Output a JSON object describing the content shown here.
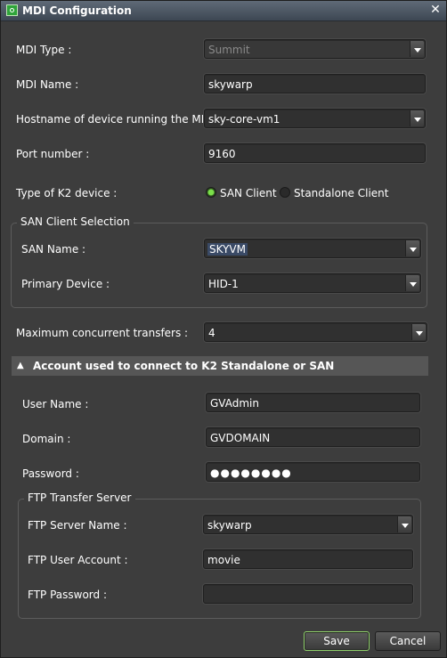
{
  "window": {
    "title": "MDI Configuration",
    "close": "✕"
  },
  "fields": {
    "mdi_type_label": "MDI Type :",
    "mdi_type_value": "Summit",
    "mdi_name_label": "MDI Name :",
    "mdi_name_value": "skywarp",
    "hostname_label": "Hostname of device running the MDI :",
    "hostname_value": "sky-core-vm1",
    "port_label": "Port number :",
    "port_value": "9160",
    "k2_type_label": "Type of K2 device :",
    "k2_option_san": "SAN Client",
    "k2_option_standalone": "Standalone Client",
    "k2_selected": "SAN Client"
  },
  "san": {
    "group_title": "SAN Client Selection",
    "san_name_label": "SAN Name :",
    "san_name_value": "SKYVM",
    "primary_label": "Primary Device :",
    "primary_value": "HID-1"
  },
  "transfers": {
    "label": "Maximum concurrent transfers :",
    "value": "4"
  },
  "account": {
    "section_title": "Account used to connect to K2 Standalone or SAN",
    "user_label": "User Name :",
    "user_value": "GVAdmin",
    "domain_label": "Domain :",
    "domain_value": "GVDOMAIN",
    "password_label": "Password :",
    "password_value": "●●●●●●●●"
  },
  "ftp": {
    "group_title": "FTP Transfer Server",
    "server_label": "FTP Server Name :",
    "server_value": "skywarp",
    "user_label": "FTP User Account :",
    "user_value": "movie",
    "password_label": "FTP Password :",
    "password_value": ""
  },
  "buttons": {
    "save": "Save",
    "cancel": "Cancel"
  },
  "icons": {
    "app": "app-icon",
    "close": "close-icon",
    "dropdown": "chevron-down-icon",
    "collapse": "chevron-up-icon"
  },
  "colors": {
    "accent_green": "#7be04a",
    "background": "#3d3d3d",
    "section_band": "#565656"
  }
}
